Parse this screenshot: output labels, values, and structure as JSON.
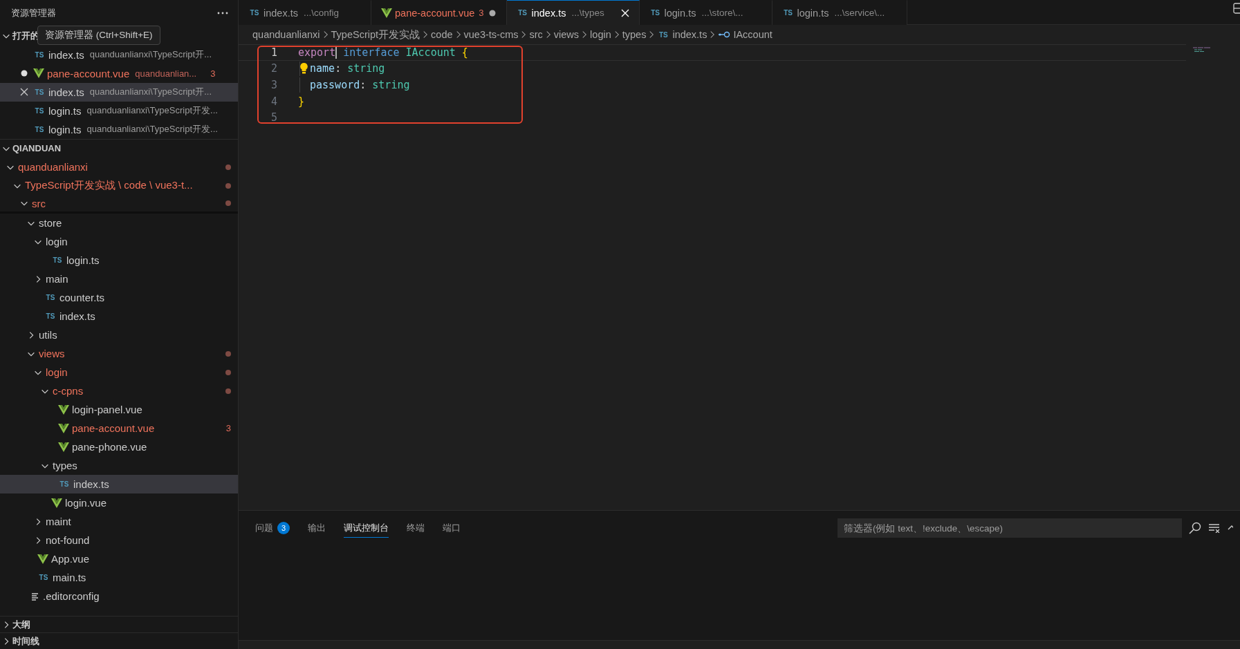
{
  "sidebar": {
    "title": "资源管理器",
    "tooltip": "资源管理器 (Ctrl+Shift+E)",
    "open_editors": {
      "title": "打开的",
      "expanded": true,
      "items": [
        {
          "kind": "ts",
          "icon": "TS",
          "name": "index.ts",
          "path": "quanduanlianxi\\TypeScript开...",
          "dirty": false,
          "modified": false,
          "selected": false
        },
        {
          "kind": "vue",
          "name": "pane-account.vue",
          "path": "quanduanlian...",
          "badge": "3",
          "dirty": true,
          "modified": true,
          "selected": false
        },
        {
          "kind": "ts",
          "icon": "TS",
          "name": "index.ts",
          "path": "quanduanlianxi\\TypeScript开...",
          "modified": false,
          "selected": true
        },
        {
          "kind": "ts",
          "icon": "TS",
          "name": "login.ts",
          "path": "quanduanlianxi\\TypeScript开发...",
          "dirty": false,
          "modified": false,
          "selected": false
        },
        {
          "kind": "ts",
          "icon": "TS",
          "name": "login.ts",
          "path": "quanduanlianxi\\TypeScript开发...",
          "dirty": false,
          "modified": false,
          "selected": false
        }
      ]
    },
    "workspace": {
      "title": "QIANDUAN",
      "expanded": true,
      "tree": [
        {
          "kind": "folder",
          "name": "quanduanlianxi",
          "expanded": true,
          "modified": true,
          "children": [
            {
              "kind": "folder",
              "name": "TypeScript开发实战 \\ code \\ vue3-t...",
              "expanded": true,
              "modified": true,
              "children": [
                {
                  "kind": "folder",
                  "name": "src",
                  "expanded": true,
                  "modified": true,
                  "sticky": true,
                  "children": [
                    {
                      "kind": "folder",
                      "name": "store",
                      "expanded": true,
                      "modified": false,
                      "children": [
                        {
                          "kind": "folder",
                          "name": "login",
                          "expanded": true,
                          "modified": false,
                          "children": [
                            {
                              "kind": "ts",
                              "icon": "TS",
                              "name": "login.ts",
                              "modified": false,
                              "selected": false
                            }
                          ]
                        },
                        {
                          "kind": "folder",
                          "name": "main",
                          "expanded": false,
                          "modified": false
                        },
                        {
                          "kind": "ts",
                          "icon": "TS",
                          "name": "counter.ts",
                          "modified": false,
                          "selected": false
                        },
                        {
                          "kind": "ts",
                          "icon": "TS",
                          "name": "index.ts",
                          "modified": false,
                          "selected": false
                        }
                      ]
                    },
                    {
                      "kind": "folder",
                      "name": "utils",
                      "expanded": false,
                      "modified": false
                    },
                    {
                      "kind": "folder",
                      "name": "views",
                      "expanded": true,
                      "modified": true,
                      "children": [
                        {
                          "kind": "folder",
                          "name": "login",
                          "expanded": true,
                          "modified": true,
                          "children": [
                            {
                              "kind": "folder",
                              "name": "c-cpns",
                              "expanded": true,
                              "modified": true,
                              "children": [
                                {
                                  "kind": "vue",
                                  "name": "login-panel.vue",
                                  "modified": false,
                                  "selected": false
                                },
                                {
                                  "kind": "vue",
                                  "name": "pane-account.vue",
                                  "modified": true,
                                  "badge": "3",
                                  "selected": false
                                },
                                {
                                  "kind": "vue",
                                  "name": "pane-phone.vue",
                                  "modified": false,
                                  "selected": false
                                }
                              ]
                            },
                            {
                              "kind": "folder",
                              "name": "types",
                              "expanded": true,
                              "modified": false,
                              "children": [
                                {
                                  "kind": "ts",
                                  "icon": "TS",
                                  "name": "index.ts",
                                  "modified": false,
                                  "selected": true
                                }
                              ]
                            },
                            {
                              "kind": "vue",
                              "name": "login.vue",
                              "modified": false,
                              "selected": false
                            }
                          ]
                        },
                        {
                          "kind": "folder",
                          "name": "maint",
                          "expanded": false,
                          "modified": false
                        },
                        {
                          "kind": "folder",
                          "name": "not-found",
                          "expanded": false,
                          "modified": false
                        }
                      ]
                    },
                    {
                      "kind": "vue",
                      "name": "App.vue",
                      "modified": false,
                      "selected": false
                    },
                    {
                      "kind": "ts",
                      "icon": "TS",
                      "name": "main.ts",
                      "modified": false,
                      "selected": false
                    }
                  ]
                },
                {
                  "kind": "config",
                  "name": ".editorconfig",
                  "modified": false,
                  "selected": false
                }
              ]
            }
          ]
        }
      ]
    },
    "sections": [
      {
        "title": "大纲",
        "expanded": false
      },
      {
        "title": "时间线",
        "expanded": false
      }
    ]
  },
  "tabs": [
    {
      "kind": "ts",
      "icon": "TS",
      "label": "index.ts",
      "description": "...\\config",
      "selected": false,
      "dirty": false,
      "modified": false
    },
    {
      "kind": "vue",
      "label": "pane-account.vue",
      "badge": "3",
      "selected": false,
      "dirty": true,
      "modified": true
    },
    {
      "kind": "ts",
      "icon": "TS",
      "label": "index.ts",
      "description": "...\\types",
      "selected": true,
      "modified": false
    },
    {
      "kind": "ts",
      "icon": "TS",
      "label": "login.ts",
      "description": "...\\store\\...",
      "selected": false,
      "dirty": false,
      "modified": false
    },
    {
      "kind": "ts",
      "icon": "TS",
      "label": "login.ts",
      "description": "...\\service\\...",
      "selected": false,
      "dirty": false,
      "modified": false
    }
  ],
  "breadcrumb": [
    {
      "kind": "folder",
      "label": "quanduanlianxi"
    },
    {
      "kind": "folder",
      "label": "TypeScript开发实战"
    },
    {
      "kind": "folder",
      "label": "code"
    },
    {
      "kind": "folder",
      "label": "vue3-ts-cms"
    },
    {
      "kind": "folder",
      "label": "src"
    },
    {
      "kind": "folder",
      "label": "views"
    },
    {
      "kind": "folder",
      "label": "login"
    },
    {
      "kind": "folder",
      "label": "types"
    },
    {
      "kind": "ts",
      "icon": "TS",
      "label": "index.ts"
    },
    {
      "kind": "interface",
      "label": "IAccount"
    }
  ],
  "editor": {
    "lines": [
      {
        "number": "1",
        "current": true,
        "indent": false,
        "lightbulb": false,
        "tokens": [
          {
            "kind": "keyword",
            "text": "export"
          },
          {
            "kind": "cursor"
          },
          {
            "kind": "storage",
            "text": " interface"
          },
          {
            "kind": "type",
            "text": " IAccount"
          },
          {
            "kind": "bracket",
            "text": " {"
          }
        ]
      },
      {
        "number": "2",
        "current": false,
        "indent": true,
        "lightbulb": true,
        "tokens": [
          {
            "kind": "property",
            "text": "name"
          },
          {
            "kind": "plain",
            "text": ":"
          },
          {
            "kind": "type",
            "text": " string"
          }
        ]
      },
      {
        "number": "3",
        "current": false,
        "indent": true,
        "lightbulb": false,
        "tokens": [
          {
            "kind": "property",
            "text": "password"
          },
          {
            "kind": "plain",
            "text": ":"
          },
          {
            "kind": "type",
            "text": " string"
          }
        ]
      },
      {
        "number": "4",
        "current": false,
        "indent": false,
        "lightbulb": false,
        "tokens": [
          {
            "kind": "bracket",
            "text": "}"
          }
        ]
      },
      {
        "number": "5",
        "current": false,
        "indent": false,
        "lightbulb": false
      }
    ],
    "annotation_frame": true
  },
  "panel": {
    "tabs": [
      {
        "label": "问题",
        "badge": "3",
        "selected": false
      },
      {
        "label": "输出",
        "selected": false
      },
      {
        "label": "调试控制台",
        "selected": true
      },
      {
        "label": "终端",
        "selected": false
      },
      {
        "label": "端口",
        "selected": false
      }
    ],
    "filter": {
      "placeholder": "筛选器(例如 text、!exclude、\\escape)"
    }
  }
}
